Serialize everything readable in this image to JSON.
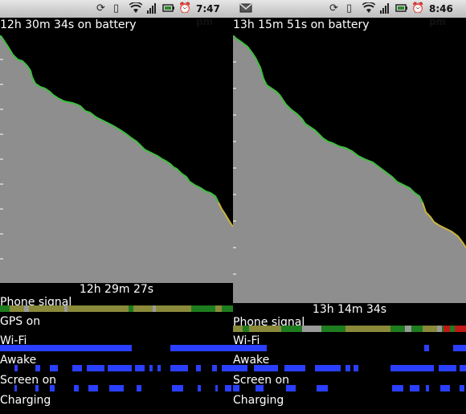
{
  "left": {
    "status": {
      "time": "7:47 pm",
      "icons": [
        "sync-icon",
        "vibrate-icon",
        "wifi-icon",
        "signal-icon",
        "battery-icon",
        "alarm-icon"
      ]
    },
    "title": "12h 30m 34s on battery",
    "duration": "12h 29m 27s",
    "rows": [
      "Phone signal",
      "GPS on",
      "Wi-Fi",
      "Awake",
      "Screen on",
      "Charging"
    ]
  },
  "right": {
    "status": {
      "time": "8:46 pm",
      "icons": [
        "gmail-icon",
        "sync-icon",
        "vibrate-icon",
        "wifi-icon",
        "signal-icon",
        "battery-icon",
        "alarm-icon"
      ]
    },
    "title": "13h 15m 51s on battery",
    "duration": "13h 14m 34s",
    "rows": [
      "Phone signal",
      "Wi-Fi",
      "Awake",
      "Screen on",
      "Charging"
    ]
  },
  "colors": {
    "graph_fill": "#8e8e8e",
    "graph_line": "#3fbf3f",
    "graph_line_low": "#c8b43c",
    "wifi": "#2a3fff",
    "signal_green": "#1e7d1e",
    "signal_olive": "#8a8a3a",
    "signal_red": "#c01818"
  }
}
